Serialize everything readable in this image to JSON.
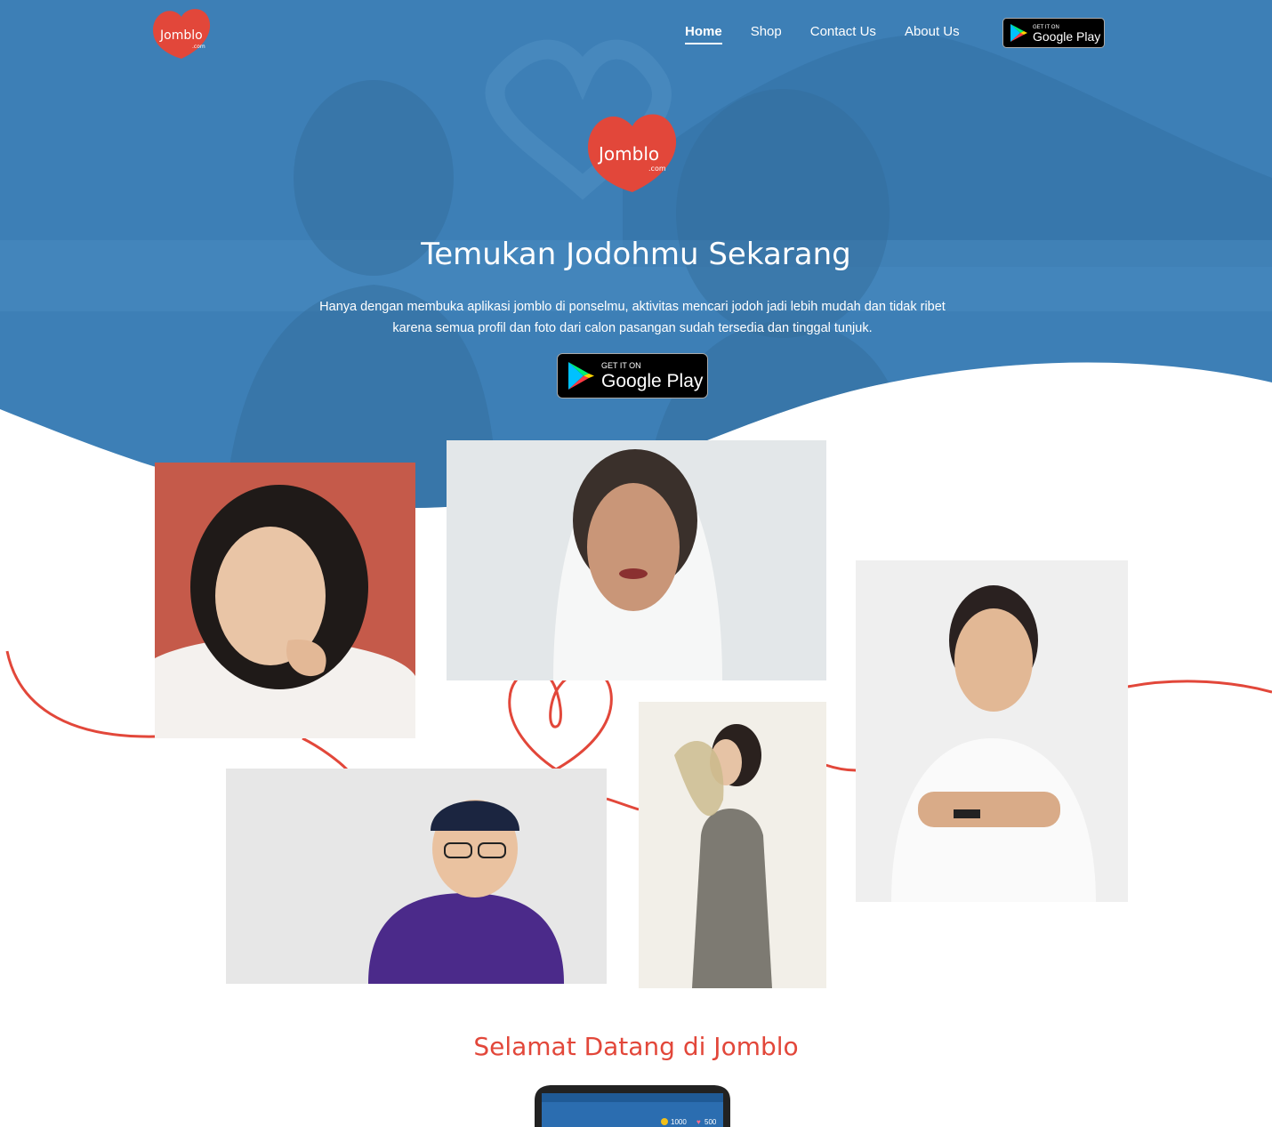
{
  "brand": {
    "logo_text": "Jomblo",
    "logo_sub": ".com",
    "accent_color": "#e2473a",
    "hero_color": "#3d7fb6"
  },
  "nav": {
    "items": [
      {
        "label": "Home",
        "active": true
      },
      {
        "label": "Shop",
        "active": false
      },
      {
        "label": "Contact Us",
        "active": false
      },
      {
        "label": "About Us",
        "active": false
      }
    ],
    "play_badge": {
      "top": "GET IT ON",
      "bottom": "Google Play"
    }
  },
  "hero": {
    "title": "Temukan Jodohmu Sekarang",
    "description": "Hanya dengan membuka aplikasi jomblo di ponselmu, aktivitas mencari jodoh jadi lebih mudah dan tidak ribet karena semua profil dan foto dari calon pasangan sudah tersedia dan tinggal tunjuk.",
    "play_badge": {
      "top": "GET IT ON",
      "bottom": "Google Play"
    }
  },
  "welcome": {
    "title": "Selamat Datang di Jomblo",
    "phone_stats": {
      "coins": "1000",
      "hearts": "500"
    }
  }
}
